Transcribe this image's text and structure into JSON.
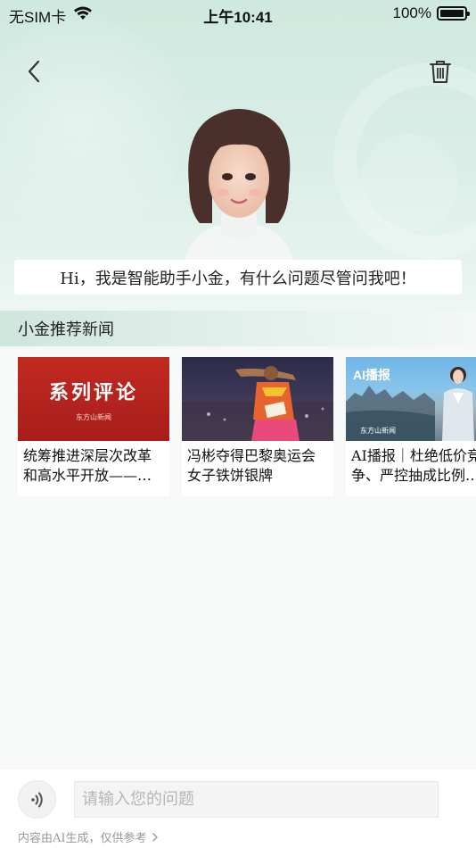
{
  "status_bar": {
    "carrier": "无SIM卡",
    "time": "上午10:41",
    "battery_percent_text": "100%",
    "battery_level": 1.0,
    "icons": [
      "wifi-icon",
      "battery-icon"
    ]
  },
  "nav": {
    "back_icon": "chevron-left-icon",
    "trash_icon": "trash-icon"
  },
  "assistant": {
    "greeting": "Hi，我是智能助手小金，有什么问题尽管问我吧！"
  },
  "recommend": {
    "title": "小金推荐新闻",
    "items": [
      {
        "title": "统筹推进深层次改革和高水平开放——…",
        "thumb_text": "系列评论",
        "thumb_logo": "东方山新闻"
      },
      {
        "title": "冯彬夺得巴黎奥运会女子铁饼银牌",
        "thumb_text": "",
        "thumb_logo": ""
      },
      {
        "title": "AI播报｜杜绝低价竞争、严控抽成比例…",
        "thumb_text": "AI播报",
        "thumb_logo": "东方山新闻"
      }
    ]
  },
  "input": {
    "placeholder": "请输入您的问题",
    "value": ""
  },
  "footer": {
    "disclaimer": "内容由AI生成，仅供参考",
    "icons": [
      "voice-icon",
      "chevron-right-icon"
    ]
  },
  "colors": {
    "accent_green": "#cfe6dc",
    "hero_bg": "#d9eee7",
    "card_red": "#c22a22"
  }
}
